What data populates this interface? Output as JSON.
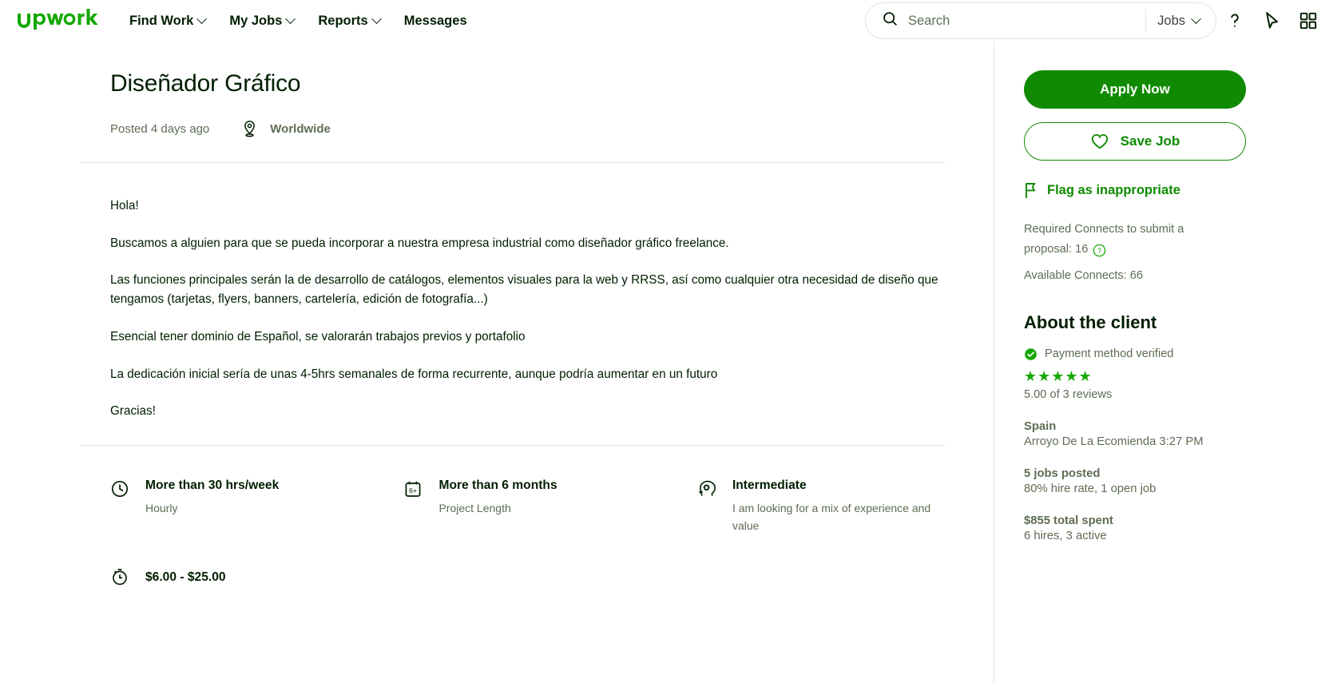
{
  "brand": {
    "name": "upwork",
    "green": "#14a800",
    "apply_green": "#108a00"
  },
  "header": {
    "nav": [
      {
        "label": "Find Work",
        "has_caret": true
      },
      {
        "label": "My Jobs",
        "has_caret": true
      },
      {
        "label": "Reports",
        "has_caret": true
      },
      {
        "label": "Messages",
        "has_caret": false
      }
    ],
    "search": {
      "placeholder": "Search",
      "value": "",
      "scope": "Jobs"
    },
    "icons": [
      "help-icon",
      "cursor-icon",
      "grid-icon"
    ]
  },
  "job": {
    "title": "Diseñador Gráfico",
    "posted": "Posted 4 days ago",
    "location": "Worldwide",
    "description": [
      "Hola!",
      "Buscamos a alguien para que se pueda incorporar a nuestra empresa industrial como diseñador gráfico freelance.",
      "Las funciones principales serán la de desarrollo de catálogos, elementos visuales para la web y RRSS, así como cualquier otra necesidad de diseño que tengamos (tarjetas, flyers, banners, cartelería, edición de fotografía...)",
      "Esencial tener dominio de Español, se valorarán trabajos previos y portafolio",
      "La dedicación inicial sería de unas 4-5hrs semanales de forma recurrente, aunque podría aumentar en un futuro",
      "Gracias!"
    ],
    "details": [
      {
        "icon": "clock-icon",
        "title": "More than 30 hrs/week",
        "sub": "Hourly"
      },
      {
        "icon": "calendar-6plus-icon",
        "title": "More than 6 months",
        "sub": "Project Length"
      },
      {
        "icon": "experience-level-icon",
        "title": "Intermediate",
        "sub": "I am looking for a mix of experience and value"
      }
    ],
    "budget": {
      "icon": "stopwatch-icon",
      "text": "$6.00 - $25.00"
    }
  },
  "sidebar": {
    "apply_label": "Apply Now",
    "save_label": "Save Job",
    "flag_label": "Flag as inappropriate",
    "connects_required_line1": "Required Connects to submit a",
    "connects_required_line2": "proposal: 16",
    "connects_available": "Available Connects: 66",
    "about_title": "About the client",
    "payment_verified": "Payment method verified",
    "rating_stars": "★★★★★",
    "reviews": "5.00 of 3 reviews",
    "country": "Spain",
    "city_time": "Arroyo De La Ecomienda 3:27 PM",
    "jobs_posted": "5 jobs posted",
    "hire_rate": "80% hire rate, 1 open job",
    "total_spent": "$855 total spent",
    "hires": "6 hires, 3 active"
  }
}
